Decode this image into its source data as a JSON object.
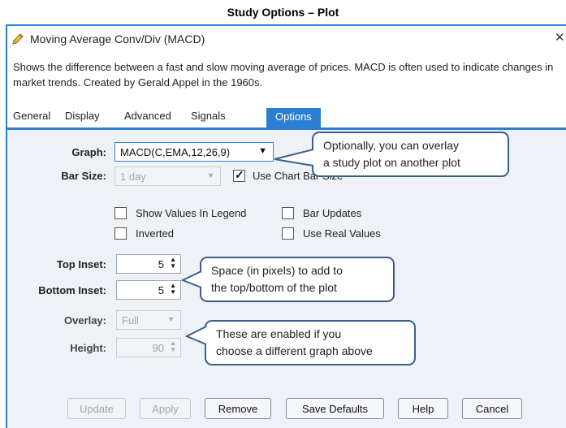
{
  "page_heading": "Study Options – Plot",
  "window": {
    "title": "Moving Average Conv/Div (MACD)",
    "title_icon": "pencil-icon",
    "close_glyph": "✕"
  },
  "description": "Shows the difference between a fast and slow moving average of prices. MACD is often used to indicate changes in market trends. Created by Gerald Appel in the 1960s.",
  "tabs": [
    {
      "label": "General",
      "active": false
    },
    {
      "label": "Display",
      "active": false
    },
    {
      "label": "Advanced",
      "active": false
    },
    {
      "label": "Signals",
      "active": false
    },
    {
      "label": "Options",
      "active": true
    }
  ],
  "form": {
    "graph_label": "Graph:",
    "graph_value": "MACD(C,EMA,12,26,9)",
    "bar_size_label": "Bar Size:",
    "bar_size_value": "1 day",
    "use_chart_bar_size_label": "Use Chart Bar Size",
    "use_chart_bar_size_checked": true,
    "show_values_in_legend_label": "Show Values In Legend",
    "show_values_in_legend_checked": false,
    "bar_updates_label": "Bar Updates",
    "bar_updates_checked": false,
    "inverted_label": "Inverted",
    "inverted_checked": false,
    "use_real_values_label": "Use Real Values",
    "use_real_values_checked": false,
    "top_inset_label": "Top Inset:",
    "top_inset_value": "5",
    "bottom_inset_label": "Bottom Inset:",
    "bottom_inset_value": "5",
    "overlay_label": "Overlay:",
    "overlay_value": "Full",
    "height_label": "Height:",
    "height_value": "90"
  },
  "callouts": {
    "graph_line1": "Optionally, you can overlay",
    "graph_line2": "a study plot on another plot",
    "inset_line1": "Space (in pixels) to add to",
    "inset_line2": "the top/bottom of the plot",
    "overlay_line1": "These are enabled if you",
    "overlay_line2": "choose a different graph above"
  },
  "buttons": {
    "update": "Update",
    "apply": "Apply",
    "remove": "Remove",
    "save_defaults": "Save Defaults",
    "help": "Help",
    "cancel": "Cancel"
  },
  "colors": {
    "accent": "#2b7fd3",
    "dialog_background": "#eef1f6",
    "callout_border": "#3a5f8a"
  }
}
